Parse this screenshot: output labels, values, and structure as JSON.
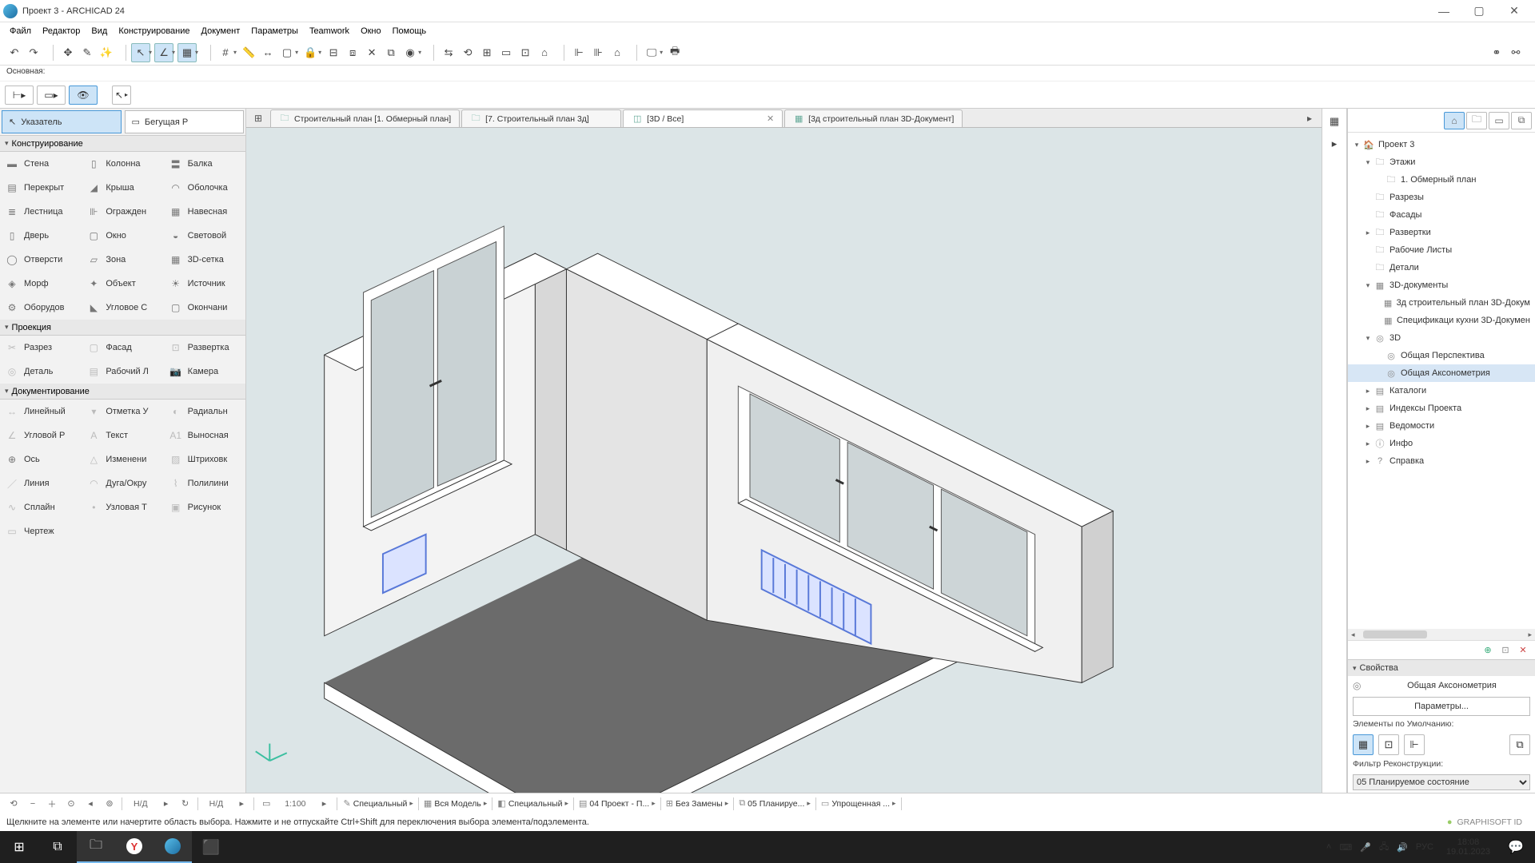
{
  "title": "Проект 3 - ARCHICAD 24",
  "win": {
    "min": "—",
    "max": "▢",
    "close": "✕"
  },
  "menu": [
    "Файл",
    "Редактор",
    "Вид",
    "Конструирование",
    "Документ",
    "Параметры",
    "Teamwork",
    "Окно",
    "Помощь"
  ],
  "row3": "Основная:",
  "sel": {
    "pointer": "Указатель",
    "marquee": "Бегущая Р"
  },
  "cat": {
    "constr": "Конструирование",
    "proj": "Проекция",
    "doc": "Документирование"
  },
  "tools": {
    "constr": [
      [
        "Стена",
        "Колонна",
        "Балка"
      ],
      [
        "Перекрыт",
        "Крыша",
        "Оболочка"
      ],
      [
        "Лестница",
        "Огражден",
        "Навесная"
      ],
      [
        "Дверь",
        "Окно",
        "Световой"
      ],
      [
        "Отверсти",
        "Зона",
        "3D-сетка"
      ],
      [
        "Морф",
        "Объект",
        "Источник"
      ],
      [
        "Оборудов",
        "Угловое С",
        "Окончани"
      ]
    ],
    "proj": [
      [
        "Разрез",
        "Фасад",
        "Развертка"
      ],
      [
        "Деталь",
        "Рабочий Л",
        "Камера"
      ]
    ],
    "doc": [
      [
        "Линейный",
        "Отметка У",
        "Радиальн"
      ],
      [
        "Угловой Р",
        "Текст",
        "Выносная"
      ],
      [
        "Ось",
        "Изменени",
        "Штриховк"
      ],
      [
        "Линия",
        "Дуга/Окру",
        "Полилини"
      ],
      [
        "Сплайн",
        "Узловая Т",
        "Рисунок"
      ],
      [
        "Чертеж",
        "",
        ""
      ]
    ]
  },
  "tabs": [
    {
      "label": "Строительный план [1. Обмерный план]",
      "active": false
    },
    {
      "label": "[7. Строительный план 3д]",
      "active": false
    },
    {
      "label": "[3D / Все]",
      "active": true,
      "closable": true
    },
    {
      "label": "[3д строительный план 3D-Документ]",
      "active": false
    }
  ],
  "nav": [
    {
      "d": 0,
      "tw": "▾",
      "ic": "🏠",
      "l": "Проект 3"
    },
    {
      "d": 1,
      "tw": "▾",
      "ic": "🗀",
      "l": "Этажи"
    },
    {
      "d": 2,
      "tw": "",
      "ic": "🗀",
      "l": "1. Обмерный план"
    },
    {
      "d": 1,
      "tw": "",
      "ic": "🗀",
      "l": "Разрезы"
    },
    {
      "d": 1,
      "tw": "",
      "ic": "🗀",
      "l": "Фасады"
    },
    {
      "d": 1,
      "tw": "▸",
      "ic": "🗀",
      "l": "Развертки"
    },
    {
      "d": 1,
      "tw": "",
      "ic": "🗀",
      "l": "Рабочие Листы"
    },
    {
      "d": 1,
      "tw": "",
      "ic": "🗀",
      "l": "Детали"
    },
    {
      "d": 1,
      "tw": "▾",
      "ic": "▦",
      "l": "3D-документы"
    },
    {
      "d": 2,
      "tw": "",
      "ic": "▦",
      "l": "3д строительный план 3D-Докум"
    },
    {
      "d": 2,
      "tw": "",
      "ic": "▦",
      "l": "Спецификаци кухни 3D-Докумен"
    },
    {
      "d": 1,
      "tw": "▾",
      "ic": "◎",
      "l": "3D"
    },
    {
      "d": 2,
      "tw": "",
      "ic": "◎",
      "l": "Общая Перспектива"
    },
    {
      "d": 2,
      "tw": "",
      "ic": "◎",
      "l": "Общая Аксонометрия",
      "sel": true
    },
    {
      "d": 1,
      "tw": "▸",
      "ic": "▤",
      "l": "Каталоги"
    },
    {
      "d": 1,
      "tw": "▸",
      "ic": "▤",
      "l": "Индексы Проекта"
    },
    {
      "d": 1,
      "tw": "▸",
      "ic": "▤",
      "l": "Ведомости"
    },
    {
      "d": 1,
      "tw": "▸",
      "ic": "ⓘ",
      "l": "Инфо"
    },
    {
      "d": 1,
      "tw": "▸",
      "ic": "?",
      "l": "Справка"
    }
  ],
  "props": {
    "hdr": "Свойства",
    "view": "Общая Аксонометрия",
    "params": "Параметры...",
    "defaults": "Элементы по Умолчанию:",
    "filter_lbl": "Фильтр Реконструкции:",
    "filter_val": "05 Планируемое состояние"
  },
  "status": {
    "nd": "Н/Д",
    "scale": "1:100",
    "segments": [
      {
        "i": "✎",
        "t": "Специальный"
      },
      {
        "i": "▦",
        "t": "Вся Модель"
      },
      {
        "i": "◧",
        "t": "Специальный"
      },
      {
        "i": "▤",
        "t": "04 Проект - П..."
      },
      {
        "i": "⊞",
        "t": "Без Замены"
      },
      {
        "i": "⧉",
        "t": "05 Планируе..."
      },
      {
        "i": "▭",
        "t": "Упрощенная ..."
      }
    ],
    "hint": "Щелкните на элементе или начертите область выбора. Нажмите и не отпускайте Ctrl+Shift для переключения выбора элемента/подэлемента.",
    "gid": "GRAPHISOFT ID"
  },
  "task": {
    "time": "18:08",
    "date": "19.01.2023",
    "lang": "РУС"
  }
}
